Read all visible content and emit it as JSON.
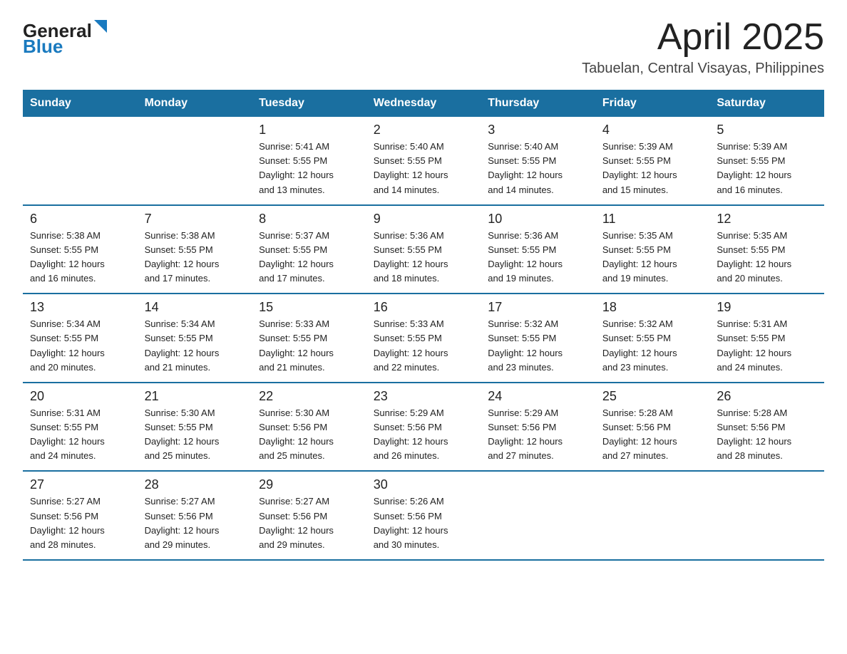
{
  "header": {
    "logo_general": "General",
    "logo_blue": "Blue",
    "month_title": "April 2025",
    "location": "Tabuelan, Central Visayas, Philippines"
  },
  "weekdays": [
    "Sunday",
    "Monday",
    "Tuesday",
    "Wednesday",
    "Thursday",
    "Friday",
    "Saturday"
  ],
  "weeks": [
    [
      {
        "day": "",
        "info": ""
      },
      {
        "day": "",
        "info": ""
      },
      {
        "day": "1",
        "info": "Sunrise: 5:41 AM\nSunset: 5:55 PM\nDaylight: 12 hours\nand 13 minutes."
      },
      {
        "day": "2",
        "info": "Sunrise: 5:40 AM\nSunset: 5:55 PM\nDaylight: 12 hours\nand 14 minutes."
      },
      {
        "day": "3",
        "info": "Sunrise: 5:40 AM\nSunset: 5:55 PM\nDaylight: 12 hours\nand 14 minutes."
      },
      {
        "day": "4",
        "info": "Sunrise: 5:39 AM\nSunset: 5:55 PM\nDaylight: 12 hours\nand 15 minutes."
      },
      {
        "day": "5",
        "info": "Sunrise: 5:39 AM\nSunset: 5:55 PM\nDaylight: 12 hours\nand 16 minutes."
      }
    ],
    [
      {
        "day": "6",
        "info": "Sunrise: 5:38 AM\nSunset: 5:55 PM\nDaylight: 12 hours\nand 16 minutes."
      },
      {
        "day": "7",
        "info": "Sunrise: 5:38 AM\nSunset: 5:55 PM\nDaylight: 12 hours\nand 17 minutes."
      },
      {
        "day": "8",
        "info": "Sunrise: 5:37 AM\nSunset: 5:55 PM\nDaylight: 12 hours\nand 17 minutes."
      },
      {
        "day": "9",
        "info": "Sunrise: 5:36 AM\nSunset: 5:55 PM\nDaylight: 12 hours\nand 18 minutes."
      },
      {
        "day": "10",
        "info": "Sunrise: 5:36 AM\nSunset: 5:55 PM\nDaylight: 12 hours\nand 19 minutes."
      },
      {
        "day": "11",
        "info": "Sunrise: 5:35 AM\nSunset: 5:55 PM\nDaylight: 12 hours\nand 19 minutes."
      },
      {
        "day": "12",
        "info": "Sunrise: 5:35 AM\nSunset: 5:55 PM\nDaylight: 12 hours\nand 20 minutes."
      }
    ],
    [
      {
        "day": "13",
        "info": "Sunrise: 5:34 AM\nSunset: 5:55 PM\nDaylight: 12 hours\nand 20 minutes."
      },
      {
        "day": "14",
        "info": "Sunrise: 5:34 AM\nSunset: 5:55 PM\nDaylight: 12 hours\nand 21 minutes."
      },
      {
        "day": "15",
        "info": "Sunrise: 5:33 AM\nSunset: 5:55 PM\nDaylight: 12 hours\nand 21 minutes."
      },
      {
        "day": "16",
        "info": "Sunrise: 5:33 AM\nSunset: 5:55 PM\nDaylight: 12 hours\nand 22 minutes."
      },
      {
        "day": "17",
        "info": "Sunrise: 5:32 AM\nSunset: 5:55 PM\nDaylight: 12 hours\nand 23 minutes."
      },
      {
        "day": "18",
        "info": "Sunrise: 5:32 AM\nSunset: 5:55 PM\nDaylight: 12 hours\nand 23 minutes."
      },
      {
        "day": "19",
        "info": "Sunrise: 5:31 AM\nSunset: 5:55 PM\nDaylight: 12 hours\nand 24 minutes."
      }
    ],
    [
      {
        "day": "20",
        "info": "Sunrise: 5:31 AM\nSunset: 5:55 PM\nDaylight: 12 hours\nand 24 minutes."
      },
      {
        "day": "21",
        "info": "Sunrise: 5:30 AM\nSunset: 5:55 PM\nDaylight: 12 hours\nand 25 minutes."
      },
      {
        "day": "22",
        "info": "Sunrise: 5:30 AM\nSunset: 5:56 PM\nDaylight: 12 hours\nand 25 minutes."
      },
      {
        "day": "23",
        "info": "Sunrise: 5:29 AM\nSunset: 5:56 PM\nDaylight: 12 hours\nand 26 minutes."
      },
      {
        "day": "24",
        "info": "Sunrise: 5:29 AM\nSunset: 5:56 PM\nDaylight: 12 hours\nand 27 minutes."
      },
      {
        "day": "25",
        "info": "Sunrise: 5:28 AM\nSunset: 5:56 PM\nDaylight: 12 hours\nand 27 minutes."
      },
      {
        "day": "26",
        "info": "Sunrise: 5:28 AM\nSunset: 5:56 PM\nDaylight: 12 hours\nand 28 minutes."
      }
    ],
    [
      {
        "day": "27",
        "info": "Sunrise: 5:27 AM\nSunset: 5:56 PM\nDaylight: 12 hours\nand 28 minutes."
      },
      {
        "day": "28",
        "info": "Sunrise: 5:27 AM\nSunset: 5:56 PM\nDaylight: 12 hours\nand 29 minutes."
      },
      {
        "day": "29",
        "info": "Sunrise: 5:27 AM\nSunset: 5:56 PM\nDaylight: 12 hours\nand 29 minutes."
      },
      {
        "day": "30",
        "info": "Sunrise: 5:26 AM\nSunset: 5:56 PM\nDaylight: 12 hours\nand 30 minutes."
      },
      {
        "day": "",
        "info": ""
      },
      {
        "day": "",
        "info": ""
      },
      {
        "day": "",
        "info": ""
      }
    ]
  ]
}
